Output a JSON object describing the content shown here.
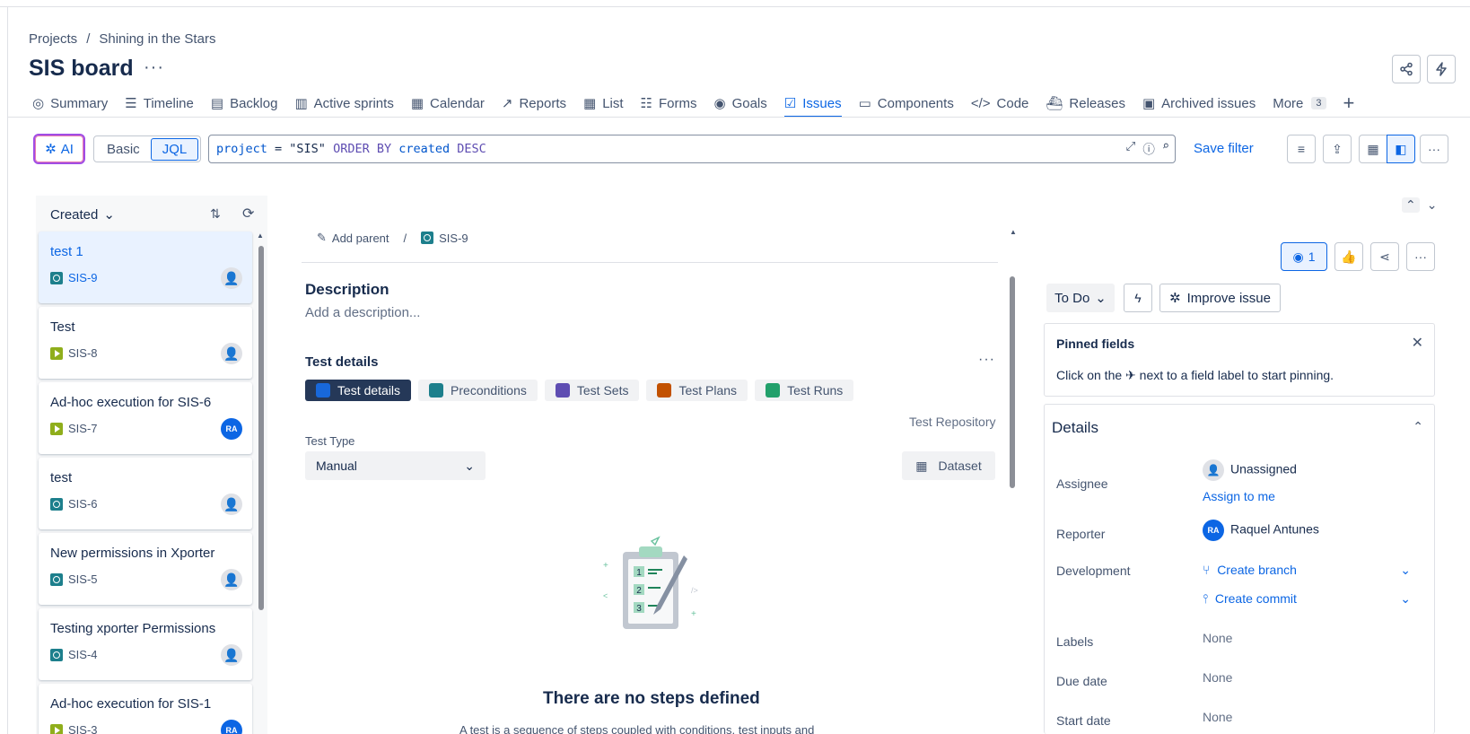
{
  "breadcrumb": {
    "root": "Projects",
    "separator": "/",
    "project": "Shining in the Stars"
  },
  "page_title": "SIS board",
  "title_more": "···",
  "nav": {
    "tabs": [
      {
        "label": "Summary",
        "icon": "globe-icon"
      },
      {
        "label": "Timeline",
        "icon": "timeline-icon"
      },
      {
        "label": "Backlog",
        "icon": "backlog-icon"
      },
      {
        "label": "Active sprints",
        "icon": "board-icon"
      },
      {
        "label": "Calendar",
        "icon": "calendar-icon"
      },
      {
        "label": "Reports",
        "icon": "chart-icon"
      },
      {
        "label": "List",
        "icon": "table-icon"
      },
      {
        "label": "Forms",
        "icon": "forms-icon"
      },
      {
        "label": "Goals",
        "icon": "target-icon"
      },
      {
        "label": "Issues",
        "icon": "issues-icon",
        "active": true
      },
      {
        "label": "Components",
        "icon": "component-icon"
      },
      {
        "label": "Code",
        "icon": "code-icon"
      },
      {
        "label": "Releases",
        "icon": "ship-icon"
      },
      {
        "label": "Archived issues",
        "icon": "archive-icon"
      }
    ],
    "more_label": "More",
    "more_count": "3",
    "add_label": "+"
  },
  "search": {
    "ai_label": "AI",
    "basic_label": "Basic",
    "jql_label": "JQL",
    "query": {
      "field1": "project",
      "op": " = ",
      "value": "\"SIS\" ",
      "kw1": "ORDER BY ",
      "field2": "created ",
      "kw2": "DESC"
    },
    "save_filter": "Save filter"
  },
  "list": {
    "sort_label": "Created",
    "items": [
      {
        "title": "test 1",
        "key": "SIS-9",
        "type": "test",
        "assignee": "unassigned",
        "selected": true
      },
      {
        "title": "Test",
        "key": "SIS-8",
        "type": "exec",
        "assignee": "unassigned"
      },
      {
        "title": "Ad-hoc execution for SIS-6",
        "key": "SIS-7",
        "type": "exec",
        "assignee": "RA"
      },
      {
        "title": "test",
        "key": "SIS-6",
        "type": "test",
        "assignee": "unassigned"
      },
      {
        "title": "New permissions in Xporter",
        "key": "SIS-5",
        "type": "test",
        "assignee": "unassigned"
      },
      {
        "title": "Testing xporter Permissions",
        "key": "SIS-4",
        "type": "test",
        "assignee": "unassigned"
      },
      {
        "title": "Ad-hoc execution for SIS-1",
        "key": "SIS-3",
        "type": "exec",
        "assignee": "RA"
      }
    ]
  },
  "issue": {
    "add_parent": "Add parent",
    "sep": "/",
    "key": "SIS-9",
    "description_heading": "Description",
    "description_placeholder": "Add a description...",
    "test_details_heading": "Test details",
    "more": "···",
    "tabs": [
      {
        "label": "Test details",
        "color": "#1868db",
        "active": true
      },
      {
        "label": "Preconditions",
        "color": "#1d7f8c"
      },
      {
        "label": "Test Sets",
        "color": "#5e4db2"
      },
      {
        "label": "Test Plans",
        "color": "#c25100"
      },
      {
        "label": "Test Runs",
        "color": "#22a06b"
      }
    ],
    "test_repository": "Test Repository",
    "test_type_label": "Test Type",
    "test_type_value": "Manual",
    "dataset_label": "Dataset",
    "no_steps_title": "There are no steps defined",
    "no_steps_sub": "A test is a sequence of steps coupled with conditions, test inputs and"
  },
  "side": {
    "watch_count": "1",
    "status": "To Do",
    "improve_label": "Improve issue",
    "pinned_title": "Pinned fields",
    "pinned_text_a": "Click on the",
    "pinned_text_b": "next to a field label to start pinning.",
    "details_title": "Details",
    "fields": {
      "assignee_label": "Assignee",
      "assignee_value": "Unassigned",
      "assign_to_me": "Assign to me",
      "reporter_label": "Reporter",
      "reporter_initials": "RA",
      "reporter_value": "Raquel Antunes",
      "development_label": "Development",
      "create_branch": "Create branch",
      "create_commit": "Create commit",
      "labels_label": "Labels",
      "labels_value": "None",
      "due_label": "Due date",
      "due_value": "None",
      "start_label": "Start date",
      "start_value": "None"
    }
  },
  "colors": {
    "accent": "#0c66e4",
    "text": "#172b4d",
    "subtle": "#44546f"
  }
}
